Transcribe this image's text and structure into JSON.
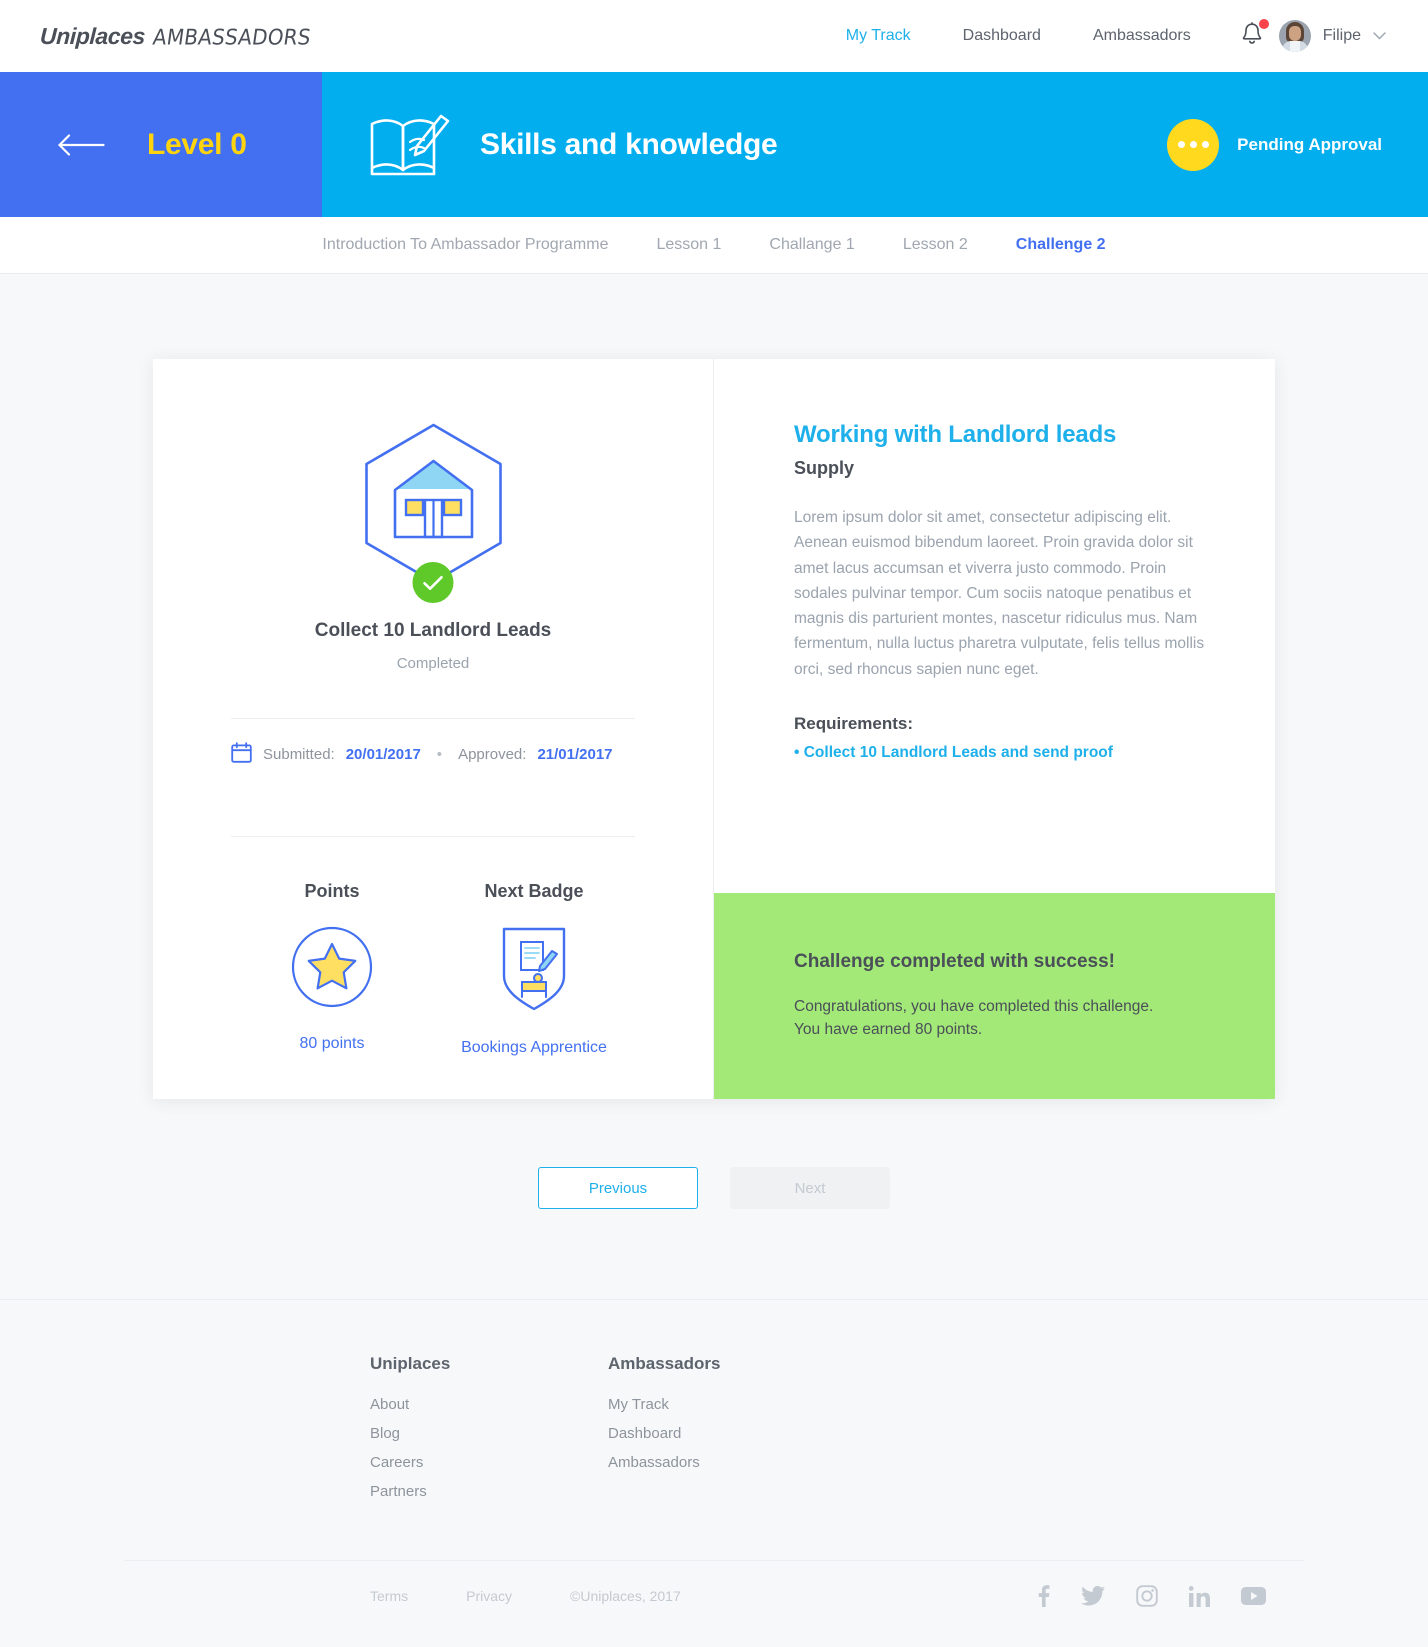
{
  "header": {
    "logo_main": "Uniplaces",
    "logo_sub": "AMBASSADORS",
    "nav": [
      {
        "label": "My Track",
        "active": true
      },
      {
        "label": "Dashboard",
        "active": false
      },
      {
        "label": "Ambassadors",
        "active": false
      }
    ],
    "notification_icon": "bell-icon",
    "has_notification": true,
    "user_name": "Filipe",
    "chevron": "⌄"
  },
  "banner": {
    "back_icon": "arrow-left-icon",
    "level_label": "Level 0",
    "section_icon": "book-pencil-icon",
    "section_title": "Skills and knowledge",
    "status_label": "Pending Approval",
    "status_icon": "ellipsis-icon",
    "colors": {
      "level_bg": "#4370f0",
      "level_text": "#ffd40f",
      "section_bg": "#03aeee",
      "status_circle": "#ffd91e"
    }
  },
  "tabs": [
    {
      "label": "Introduction To Ambassador Programme",
      "active": false
    },
    {
      "label": "Lesson 1",
      "active": false
    },
    {
      "label": "Challange 1",
      "active": false
    },
    {
      "label": "Lesson 2",
      "active": false
    },
    {
      "label": "Challenge 2",
      "active": true
    }
  ],
  "challenge_card": {
    "badge_icon": "house-hexagon-badge-icon",
    "completed_icon": "check-icon",
    "badge_title": "Collect 10 Landlord Leads",
    "badge_status": "Completed",
    "calendar_icon": "calendar-icon",
    "submitted_label": "Submitted:",
    "submitted_date": "20/01/2017",
    "separator": "•",
    "approved_label": "Approved:",
    "approved_date": "21/01/2017",
    "stats": [
      {
        "label": "Points",
        "icon": "star-circle-icon",
        "value": "80 points"
      },
      {
        "label": "Next Badge",
        "icon": "shield-badge-icon",
        "value": "Bookings Apprentice"
      }
    ]
  },
  "lesson": {
    "title": "Working with Landlord leads",
    "subtitle": "Supply",
    "body": "Lorem ipsum dolor sit amet, consectetur adipiscing elit. Aenean euismod bibendum laoreet. Proin gravida dolor sit amet lacus accumsan et viverra justo commodo. Proin sodales pulvinar tempor. Cum sociis natoque penatibus et magnis dis parturient montes, nascetur ridiculus mus. Nam fermentum, nulla luctus pharetra vulputate, felis tellus mollis orci, sed rhoncus sapien nunc eget.",
    "requirements_heading": "Requirements:",
    "requirements": [
      "• Collect 10 Landlord Leads and send proof"
    ]
  },
  "success": {
    "title": "Challenge completed with success!",
    "line1": "Congratulations, you have completed this challenge.",
    "line2": "You have earned 80 points.",
    "bg_color": "#a3e978"
  },
  "pager": {
    "previous_label": "Previous",
    "next_label": "Next"
  },
  "footer": {
    "columns": [
      {
        "heading": "Uniplaces",
        "links": [
          "About",
          "Blog",
          "Careers",
          "Partners"
        ]
      },
      {
        "heading": "Ambassadors",
        "links": [
          "My Track",
          "Dashboard",
          "Ambassadors"
        ]
      }
    ],
    "terms": "Terms",
    "privacy": "Privacy",
    "copyright": "©Uniplaces, 2017",
    "socials": [
      "facebook-icon",
      "twitter-icon",
      "instagram-icon",
      "linkedin-icon",
      "youtube-icon"
    ]
  }
}
